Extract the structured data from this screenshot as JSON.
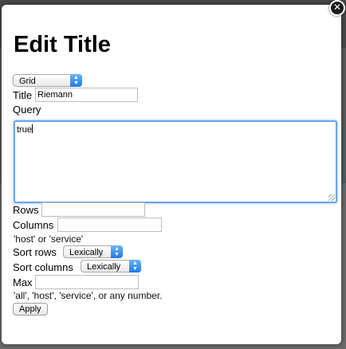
{
  "dialog": {
    "title": "Edit Title",
    "close_glyph": "✕",
    "close_icon": "close-icon"
  },
  "form": {
    "view_type": {
      "selected": "Grid"
    },
    "title": {
      "label": "Title",
      "value": "Riemann"
    },
    "query": {
      "label": "Query",
      "value": "true"
    },
    "rows": {
      "label": "Rows",
      "value": ""
    },
    "columns": {
      "label": "Columns",
      "value": "",
      "help": "'host' or 'service'"
    },
    "sort_rows": {
      "label": "Sort rows",
      "selected": "Lexically"
    },
    "sort_columns": {
      "label": "Sort columns",
      "selected": "Lexically"
    },
    "max": {
      "label": "Max",
      "value": "",
      "help": "'all', 'host', 'service', or any number."
    },
    "apply_label": "Apply"
  },
  "colors": {
    "select_arrow_accent": "#1f7ae6",
    "textarea_focus": "#6aa7ea"
  }
}
